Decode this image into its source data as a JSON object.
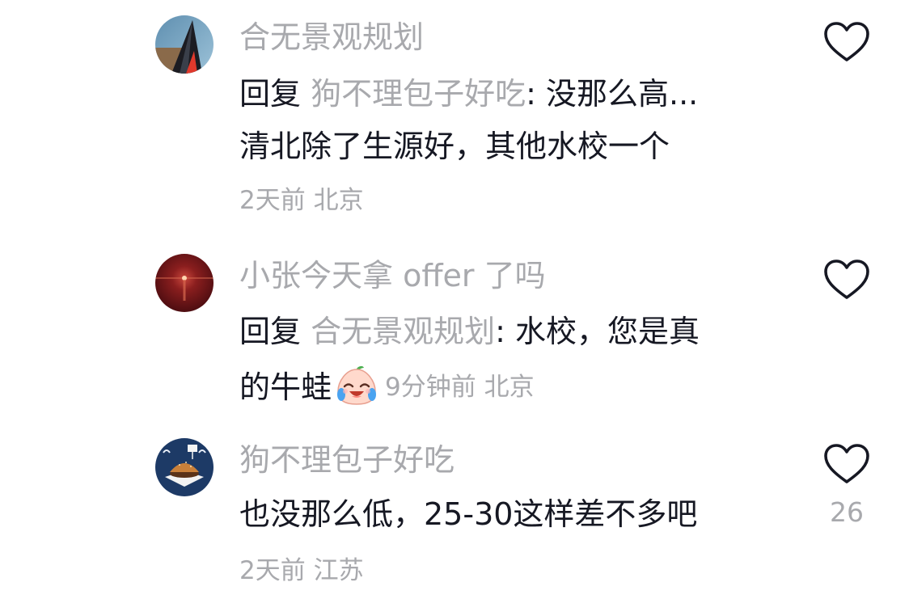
{
  "comments": [
    {
      "username": "合无景观规划",
      "reply_prefix": "回复",
      "reply_to": "狗不理包子好吃",
      "line1_text": ": 没那么高...",
      "line2_text": "清北除了生源好，其他水校一个",
      "time": "2天前",
      "location": "北京",
      "avatar_icon": "pyramid-avatar-icon"
    },
    {
      "username": "小张今天拿 offer 了吗",
      "reply_prefix": "回复",
      "reply_to": "合无景观规划",
      "line1_text": ": 水校，您是真",
      "line2_text": "的牛蛙",
      "emoji": "crying-laughing-bun-emoji",
      "time": "9分钟前",
      "location": "北京",
      "avatar_icon": "sunset-sea-avatar-icon"
    },
    {
      "username": "狗不理包子好吃",
      "text": "也没那么低，25-30这样差不多吧",
      "time": "2天前",
      "location": "江苏",
      "like_count": "26",
      "avatar_icon": "burger-avatar-icon"
    }
  ],
  "like_icon": "heart-outline-icon",
  "colors": {
    "secondary_text": "#a8a9ad",
    "primary_text": "#161823",
    "background": "#ffffff"
  }
}
